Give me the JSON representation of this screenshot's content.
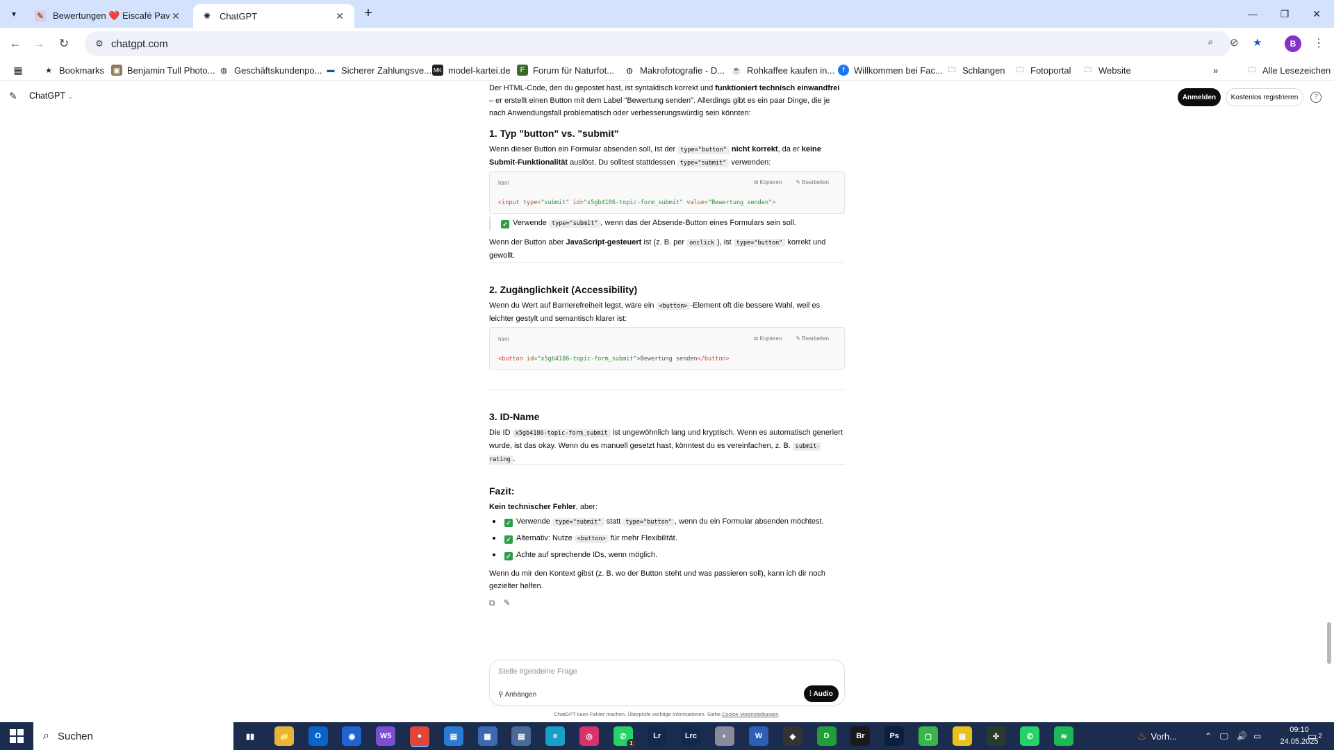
{
  "browser": {
    "tabs": [
      {
        "title": "Bewertungen ❤️ Eiscafé Pavillo",
        "active": false
      },
      {
        "title": "ChatGPT",
        "active": true
      }
    ],
    "url": "chatgpt.com",
    "profile_initial": "B",
    "bookmarks": [
      {
        "label": "Bookmarks",
        "icon": "star-icon"
      },
      {
        "label": "Benjamin Tull Photo...",
        "icon": "photo-icon"
      },
      {
        "label": "Geschäftskundenpo...",
        "icon": "globe-icon"
      },
      {
        "label": "Sicherer Zahlungsve...",
        "icon": "payment-icon"
      },
      {
        "label": "model-kartei.de",
        "icon": "mk-icon"
      },
      {
        "label": "Forum für Naturfot...",
        "icon": "forum-icon"
      },
      {
        "label": "Makrofotografie - D...",
        "icon": "globe-icon"
      },
      {
        "label": "Rohkaffee kaufen in...",
        "icon": "coffee-icon"
      },
      {
        "label": "Willkommen bei Fac...",
        "icon": "facebook-icon"
      },
      {
        "label": "Schlangen",
        "icon": "folder-icon"
      },
      {
        "label": "Fotoportal",
        "icon": "folder-icon"
      },
      {
        "label": "Website",
        "icon": "folder-icon"
      }
    ],
    "all_bookmarks": "Alle Lesezeichen"
  },
  "header": {
    "model": "ChatGPT",
    "login": "Anmelden",
    "register": "Kostenlos registrieren"
  },
  "chat": {
    "intro_a": "Der HTML-Code, den du gepostet hast, ist syntaktisch korrekt und ",
    "intro_b": "funktioniert technisch einwandfrei",
    "intro_c": " – er erstellt einen Button mit dem Label \"Bewertung senden\". Allerdings gibt es ein paar Dinge, die je nach Anwendungsfall problematisch oder verbesserungswürdig sein könnten:",
    "s1_num": "1.",
    "s1_title": "Typ \"button\" vs. \"submit\"",
    "s1_p_a": "Wenn dieser Button ein Formular absenden soll, ist der ",
    "s1_p_code1": "type=\"button\"",
    "s1_p_b": " nicht korrekt",
    "s1_p_c": ", da er ",
    "s1_p_d": "keine Submit-Funktionalität",
    "s1_p_e": " auslöst. Du solltest stattdessen ",
    "s1_p_code2": "type=\"submit\"",
    "s1_p_f": " verwenden:",
    "code_lang": "html",
    "code_copy": "⧉ Kopieren",
    "code_edit": "✎ Bearbeiten",
    "code1_tag_open": "<input",
    "code1_a1": " type=",
    "code1_v1": "\"submit\"",
    "code1_a2": " id=",
    "code1_v2": "\"x5gb4186-topic-form_submit\"",
    "code1_a3": " value=",
    "code1_v3": "\"Bewertung senden\"",
    "code1_tag_close": ">",
    "s1_quote_a": "Verwende ",
    "s1_quote_code": "type=\"submit\"",
    "s1_quote_b": ", wenn das der Absende-Button eines Formulars sein soll.",
    "s1_p2_a": "Wenn der Button aber ",
    "s1_p2_b": "JavaScript-gesteuert",
    "s1_p2_c": " ist (z. B. per ",
    "s1_p2_code1": "onclick",
    "s1_p2_d": "), ist ",
    "s1_p2_code2": "type=\"button\"",
    "s1_p2_e": " korrekt und gewollt.",
    "s2_num": "2.",
    "s2_title": "Zugänglichkeit (Accessibility)",
    "s2_p_a": "Wenn du Wert auf Barrierefreiheit legst, wäre ein ",
    "s2_p_code": "<button>",
    "s2_p_b": "-Element oft die bessere Wahl, weil es leichter gestylt und semantisch klarer ist:",
    "code2_tag_open": "<button",
    "code2_a1": " id=",
    "code2_v1": "\"x5gb4186-topic-form_submit\"",
    "code2_text": ">Bewertung senden",
    "code2_tag_close": "</button>",
    "s3_num": "3.",
    "s3_title": "ID-Name",
    "s3_p_a": "Die ID ",
    "s3_p_code1": "x5gb4186-topic-form_submit",
    "s3_p_b": " ist ungewöhnlich lang und kryptisch. Wenn es automatisch generiert wurde, ist das okay. Wenn du es manuell gesetzt hast, könntest du es vereinfachen, z. B. ",
    "s3_p_code2": "submit-rating",
    "s3_p_c": ".",
    "fazit_title": "Fazit:",
    "fazit_sub": "Kein technischer Fehler",
    "fazit_sub_b": ", aber:",
    "b1_a": "Verwende ",
    "b1_code1": "type=\"submit\"",
    "b1_b": " statt ",
    "b1_code2": "type=\"button\"",
    "b1_c": ", wenn du ein Formular absenden möchtest.",
    "b2_a": "Alternativ: Nutze ",
    "b2_code": "<button>",
    "b2_b": " für mehr Flexibilität.",
    "b3_a": "Achte auf sprechende IDs, wenn möglich.",
    "outro": "Wenn du mir den Kontext gibst (z. B. wo der Button steht und was passieren soll), kann ich dir noch gezielter helfen."
  },
  "composer": {
    "placeholder": "Stelle irgendeine Frage",
    "attach": "Anhängen",
    "audio": "Audio"
  },
  "disclaimer": {
    "text": "ChatGPT kann Fehler machen. Überprüfe wichtige Informationen. Siehe ",
    "link": "Cookie-Voreinstellungen",
    "end": "."
  },
  "taskbar": {
    "search": "Suchen",
    "weather": "Vorh...",
    "time": "09:10",
    "date": "24.05.2025",
    "notification_count": "2",
    "whatsapp_badge": "1",
    "apps": [
      {
        "name": "task-view-icon",
        "label": "▮▮",
        "color": "#1c2c4e"
      },
      {
        "name": "file-explorer-icon",
        "label": "📁",
        "color": "#e8b43a"
      },
      {
        "name": "outlook-icon",
        "label": "O",
        "color": "#0a64c8"
      },
      {
        "name": "app-blue-icon",
        "label": "◉",
        "color": "#1e64d2"
      },
      {
        "name": "w5-icon",
        "label": "W5",
        "color": "#7b4fd0"
      },
      {
        "name": "chrome-icon",
        "label": "●",
        "color": "#e0463a"
      },
      {
        "name": "file-manager-icon",
        "label": "▤",
        "color": "#2a7bd6"
      },
      {
        "name": "calculator-icon",
        "label": "▦",
        "color": "#3a6bb0"
      },
      {
        "name": "notes-icon",
        "label": "▤",
        "color": "#4a6a9a"
      },
      {
        "name": "edge-icon",
        "label": "e",
        "color": "#1aa0c8"
      },
      {
        "name": "instagram-icon",
        "label": "◎",
        "color": "#d6336c"
      },
      {
        "name": "whatsapp-icon",
        "label": "✆",
        "color": "#25d366"
      },
      {
        "name": "lightroom-icon",
        "label": "Lr",
        "color": "#0f2a4a"
      },
      {
        "name": "lightroom-classic-icon",
        "label": "Lrc",
        "color": "#0f2a4a"
      },
      {
        "name": "app-gray-icon",
        "label": "◐",
        "color": "#8a8a9a"
      },
      {
        "name": "word-icon",
        "label": "W",
        "color": "#2b5fb8"
      },
      {
        "name": "app-dark-icon",
        "label": "◆",
        "color": "#333"
      },
      {
        "name": "app-green-icon",
        "label": "D",
        "color": "#1f9e3a"
      },
      {
        "name": "bridge-icon",
        "label": "Br",
        "color": "#1a1a1a"
      },
      {
        "name": "photoshop-icon",
        "label": "Ps",
        "color": "#0a1f3d"
      },
      {
        "name": "app-lightgreen-icon",
        "label": "▢",
        "color": "#3ab54a"
      },
      {
        "name": "calendar-app-icon",
        "label": "▤",
        "color": "#e8c21a"
      },
      {
        "name": "app-cross-icon",
        "label": "✣",
        "color": "#2a3a2a"
      },
      {
        "name": "whatsapp-desktop-icon",
        "label": "✆",
        "color": "#25d366"
      },
      {
        "name": "spotify-icon",
        "label": "≋",
        "color": "#1db954"
      }
    ]
  }
}
